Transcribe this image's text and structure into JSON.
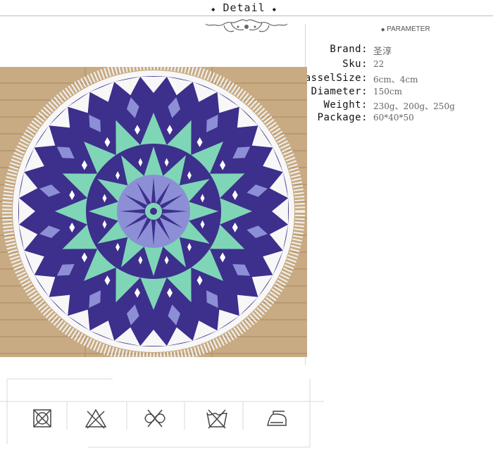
{
  "header": {
    "title": "Detail"
  },
  "parameter": {
    "title": "PARAMETER",
    "bullet": "◆"
  },
  "specs": [
    {
      "label": "Brand:",
      "value": "圣淳"
    },
    {
      "label": "Sku:",
      "value": "22"
    },
    {
      "label": "TasselSize:",
      "value": "6cm、4cm"
    },
    {
      "label": "Diameter:",
      "value": "150cm"
    },
    {
      "label": "Weight:",
      "value": "230g、200g、250g"
    },
    {
      "label": "Package:",
      "value": "60*40*50"
    }
  ],
  "product_photo": {
    "description_icon": "round-mandala-beach-towel-image",
    "colors": {
      "floor": "#c9ad85",
      "towel_purple": "#3d2f8c",
      "towel_mint": "#7fd6b6",
      "towel_lavender": "#8d8fd6",
      "towel_white": "#f7f7f7"
    }
  },
  "care_icons": [
    {
      "icon": "tumble-dry-icon"
    },
    {
      "icon": "do-not-bleach-icon"
    },
    {
      "icon": "do-not-wring-icon"
    },
    {
      "icon": "do-not-wash-icon"
    },
    {
      "icon": "iron-icon"
    }
  ]
}
